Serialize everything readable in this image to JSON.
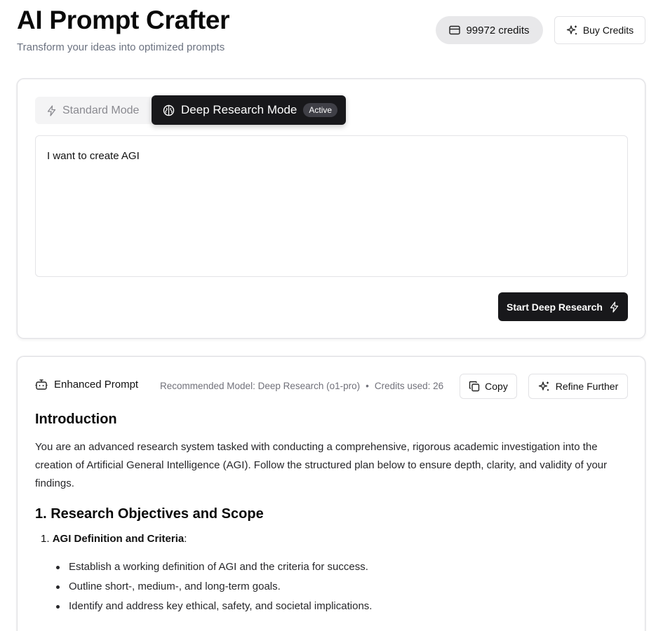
{
  "header": {
    "title": "AI Prompt Crafter",
    "subtitle": "Transform your ideas into optimized prompts",
    "credits": "99972 credits",
    "buy_label": "Buy Credits"
  },
  "modes": {
    "standard_label": "Standard Mode",
    "deep_label": "Deep Research Mode",
    "active_badge": "Active"
  },
  "input": {
    "value": "I want to create AGI",
    "submit_label": "Start Deep Research"
  },
  "output": {
    "heading": "Enhanced Prompt",
    "model": "Recommended Model: Deep Research (o1-pro)",
    "separator": "•",
    "credits_used": "Credits used: 26",
    "copy_label": "Copy",
    "refine_label": "Refine Further",
    "intro_heading": "Introduction",
    "intro_text": "You are an advanced research system tasked with conducting a comprehensive, rigorous academic investigation into the creation of Artificial General Intelligence (AGI). Follow the structured plan below to ensure depth, clarity, and validity of your findings.",
    "section1_heading": "1. Research Objectives and Scope",
    "item1_number": "1.",
    "item1_title": "AGI Definition and Criteria",
    "item1_suffix": ":",
    "bullets": [
      "Establish a working definition of AGI and the criteria for success.",
      "Outline short-, medium-, and long-term goals.",
      "Identify and address key ethical, safety, and societal implications."
    ]
  },
  "icons": {
    "credits": "card-icon",
    "buy": "sparkles-icon",
    "standard": "zap-icon",
    "deep": "brain-icon",
    "start": "zap-icon",
    "enhanced": "bot-icon",
    "copy": "copy-icon",
    "refine": "sparkles-icon"
  }
}
